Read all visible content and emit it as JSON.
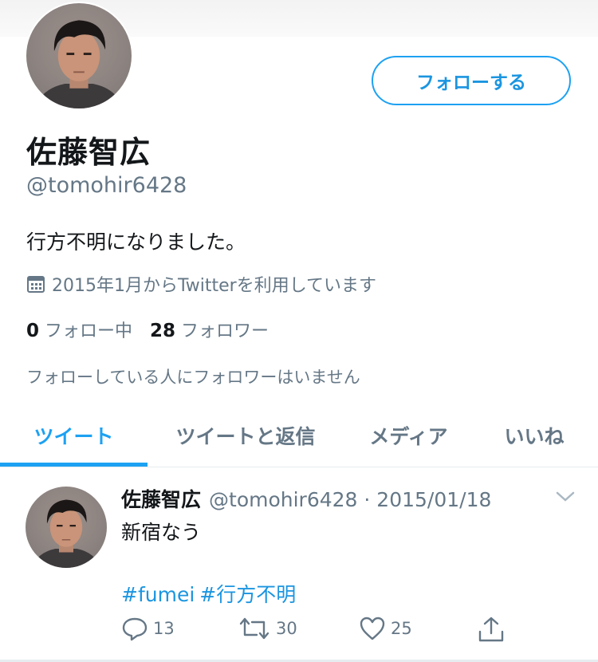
{
  "profile": {
    "display_name": "佐藤智広",
    "handle": "@tomohir6428",
    "bio": "行方不明になりました。",
    "joined": "2015年1月からTwitterを利用しています",
    "following_count": "0",
    "following_label": "フォロー中",
    "followers_count": "28",
    "followers_label": "フォロワー",
    "followers_note": "フォローしている人にフォロワーはいません",
    "follow_button": "フォローする"
  },
  "tabs": [
    {
      "label": "ツイート",
      "active": true
    },
    {
      "label": "ツイートと返信",
      "active": false
    },
    {
      "label": "メディア",
      "active": false
    },
    {
      "label": "いいね",
      "active": false
    }
  ],
  "tweet": {
    "name": "佐藤智広",
    "meta": "@tomohir6428 · 2015/01/18",
    "text": "新宿なう",
    "hashtags": [
      "#fumei",
      "#行方不明"
    ],
    "reply_count": "13",
    "retweet_count": "30",
    "like_count": "25"
  },
  "colors": {
    "accent": "#1da1f2",
    "text": "#14171a",
    "secondary": "#657786"
  }
}
